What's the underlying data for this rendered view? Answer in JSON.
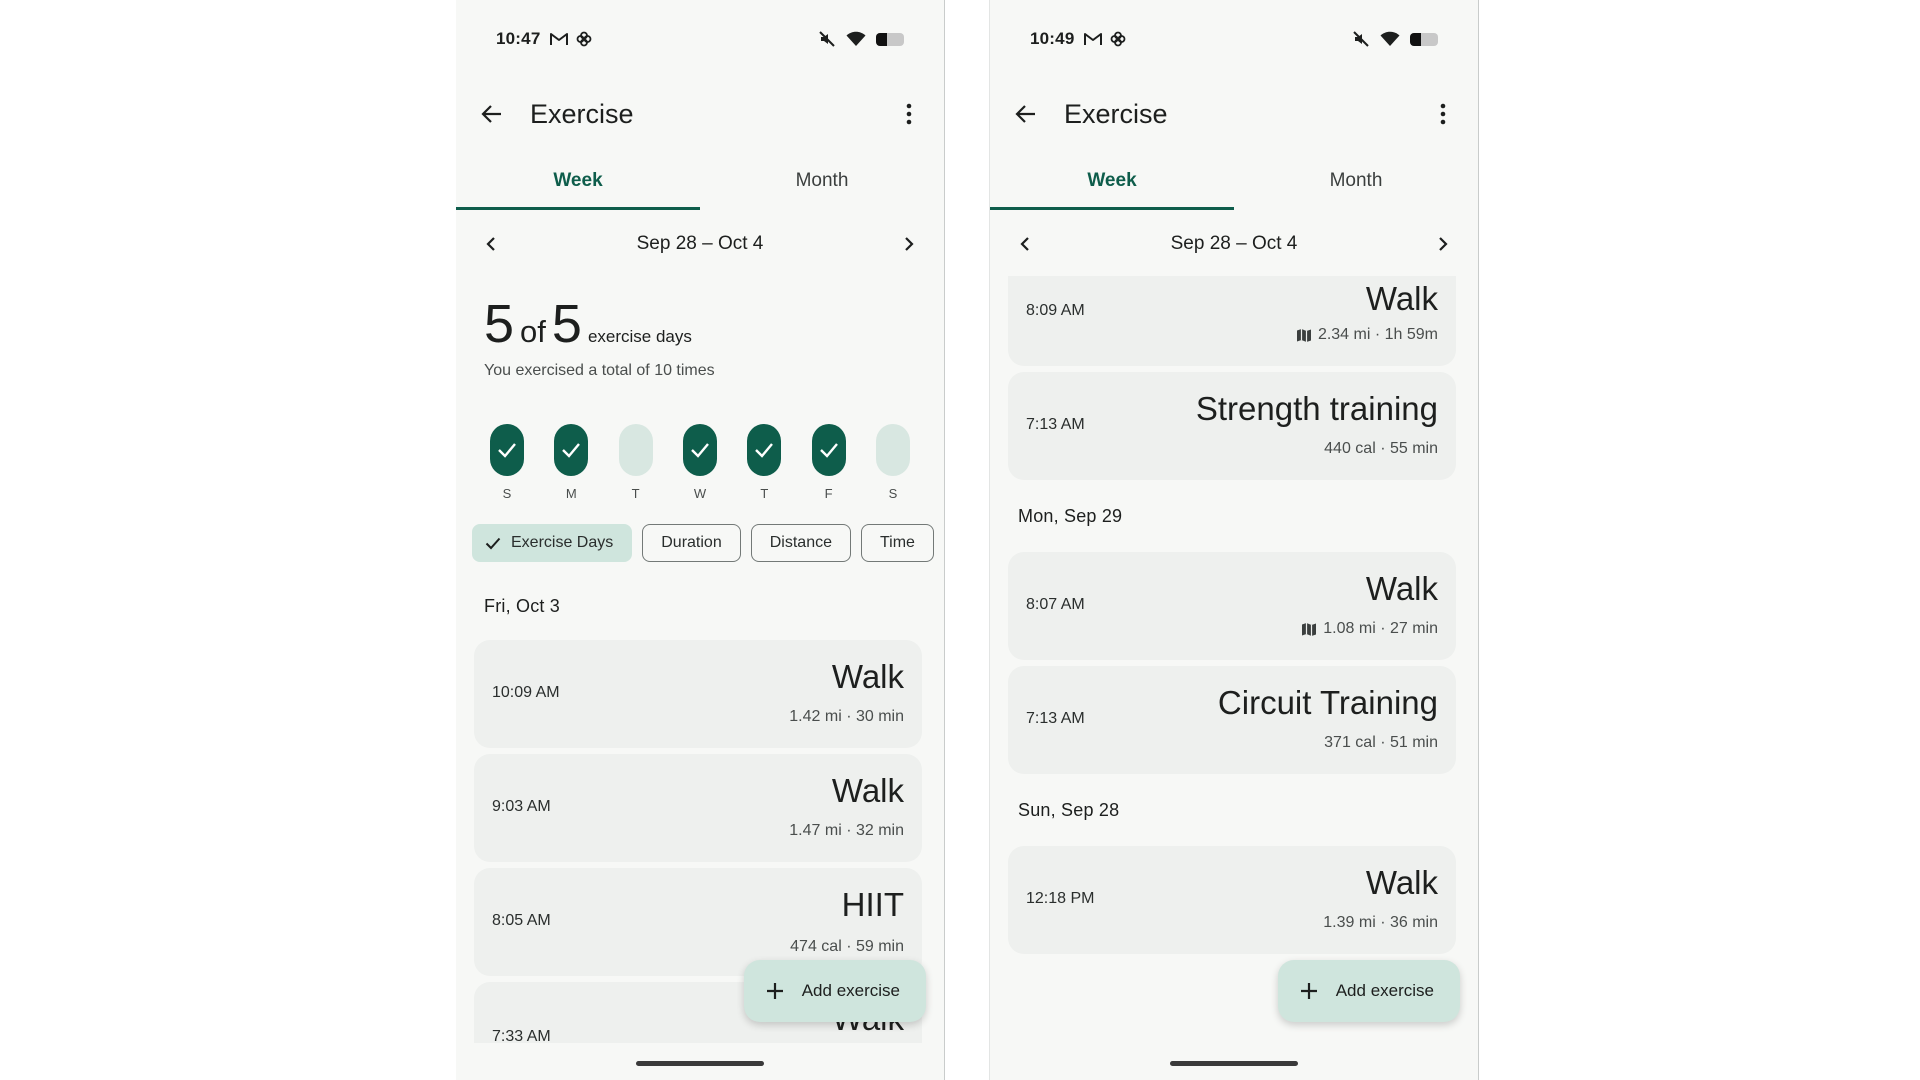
{
  "left": {
    "status": {
      "time": "10:47"
    },
    "title": "Exercise",
    "tabs": [
      "Week",
      "Month"
    ],
    "week_label": "Sep 28 – Oct 4",
    "summary": {
      "done": "5",
      "of": "of",
      "total": "5",
      "unit": "exercise days",
      "subtitle": "You exercised a total of 10 times"
    },
    "days": [
      {
        "letter": "S",
        "done": true
      },
      {
        "letter": "M",
        "done": true
      },
      {
        "letter": "T",
        "done": false
      },
      {
        "letter": "W",
        "done": true
      },
      {
        "letter": "T",
        "done": true
      },
      {
        "letter": "F",
        "done": true
      },
      {
        "letter": "S",
        "done": false
      }
    ],
    "chips": [
      "Exercise Days",
      "Duration",
      "Distance",
      "Time"
    ],
    "section": "Fri, Oct 3",
    "entries": [
      {
        "time": "10:09 AM",
        "name": "Walk",
        "detail": "1.42 mi · 30 min"
      },
      {
        "time": "9:03 AM",
        "name": "Walk",
        "detail": "1.47 mi · 32 min"
      },
      {
        "time": "8:05 AM",
        "name": "HIIT",
        "detail": "474 cal · 59 min"
      },
      {
        "time": "7:33 AM",
        "name": "Walk",
        "detail": ""
      }
    ],
    "fab_label": "Add exercise"
  },
  "right": {
    "status": {
      "time": "10:49"
    },
    "title": "Exercise",
    "tabs": [
      "Week",
      "Month"
    ],
    "week_label": "Sep 28 – Oct 4",
    "entries_top": [
      {
        "time": "8:09 AM",
        "name": "Walk",
        "detail": "2.34 mi · 1h 59m",
        "map_icon": true
      },
      {
        "time": "7:13 AM",
        "name": "Strength training",
        "detail": "440 cal · 55 min"
      }
    ],
    "section_2": "Mon, Sep 29",
    "entries_mid": [
      {
        "time": "8:07 AM",
        "name": "Walk",
        "detail": "1.08 mi · 27 min",
        "map_icon": true
      },
      {
        "time": "7:13 AM",
        "name": "Circuit Training",
        "detail": "371 cal · 51 min"
      }
    ],
    "section_3": "Sun, Sep 28",
    "entries_bottom": [
      {
        "time": "12:18 PM",
        "name": "Walk",
        "detail": "1.39 mi · 36 min"
      }
    ],
    "fab_label": "Add exercise"
  },
  "colors": {
    "accent": "#0e5d4b",
    "accent_light": "#cfe5dd",
    "pill_empty": "#d8e7e1",
    "card": "#eef0ee",
    "background": "#f7f8f6"
  },
  "icons": [
    "gmail-icon",
    "pinwheel-icon",
    "mute-icon",
    "wifi-icon",
    "battery-icon",
    "back-arrow-icon",
    "more-vert-icon",
    "chevron-left-icon",
    "chevron-right-icon",
    "check-icon",
    "map-icon",
    "plus-icon"
  ]
}
